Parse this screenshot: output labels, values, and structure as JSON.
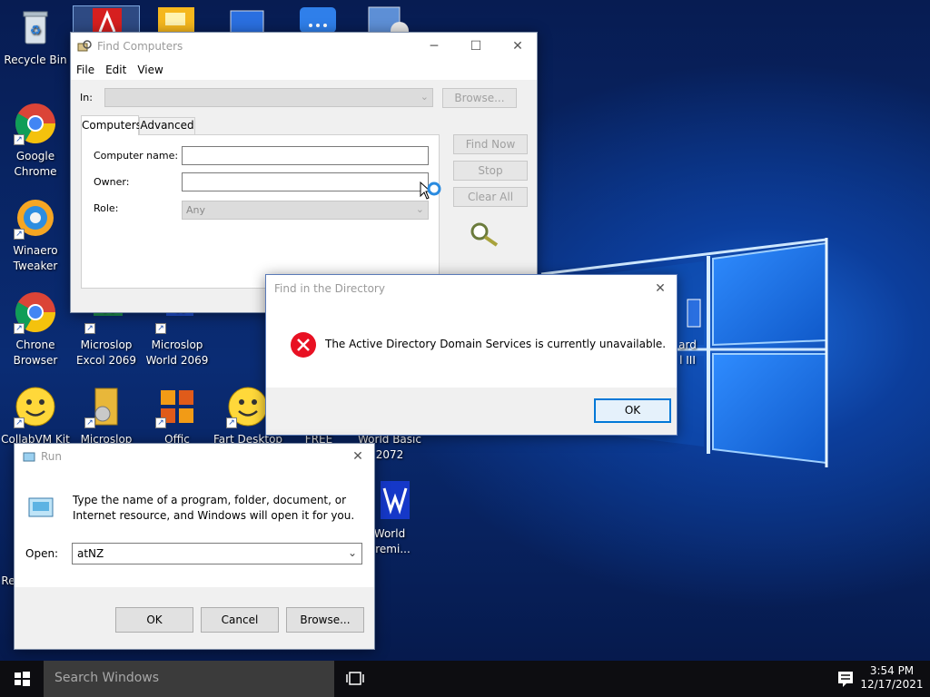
{
  "desktop": {
    "icons": [
      {
        "label": "Recycle Bin",
        "icon": "recycle-bin-icon"
      },
      {
        "label": "Google\nChrome",
        "icon": "chrome-icon"
      },
      {
        "label": "Winaero\nTweaker",
        "icon": "winaero-tweaker-icon"
      },
      {
        "label": "Chrone\nBrowser",
        "icon": "chrome-icon"
      },
      {
        "label": "CollabVM Kit",
        "icon": "smiley-icon"
      },
      {
        "label": "Microslop\nExcol 2069",
        "icon": "excel-icon"
      },
      {
        "label": "Microslop\nWorld 2069",
        "icon": "word-icon"
      },
      {
        "label": "Microslop",
        "icon": "folder-disc-icon"
      },
      {
        "label": "Offic",
        "icon": "office-logo-icon"
      },
      {
        "label": "Fart Desktop",
        "icon": "smiley-icon"
      },
      {
        "label": "FREE",
        "icon": "free-icon"
      },
      {
        "label": "World Basic\n2072",
        "icon": "app-icon"
      },
      {
        "label": "World\nPremi...",
        "icon": "word-premium-icon"
      },
      {
        "label": "ard\nl III",
        "icon": "app-icon"
      },
      {
        "label": "Re",
        "icon": "app-icon"
      }
    ]
  },
  "find_computers": {
    "title": "Find Computers",
    "menu": [
      "File",
      "Edit",
      "View"
    ],
    "in_label": "In:",
    "browse_label": "Browse...",
    "tabs": [
      "Computers",
      "Advanced"
    ],
    "computer_name_label": "Computer name:",
    "owner_label": "Owner:",
    "role_label": "Role:",
    "role_value": "Any",
    "find_now_label": "Find Now",
    "stop_label": "Stop",
    "clear_all_label": "Clear All"
  },
  "error_dialog": {
    "title": "Find in the Directory",
    "message": "The Active Directory Domain Services is currently unavailable.",
    "ok_label": "OK"
  },
  "run_dialog": {
    "title": "Run",
    "description": "Type the name of a program, folder, document, or\nInternet resource, and Windows will open it for you.",
    "open_label": "Open:",
    "open_value": "atNZ",
    "ok_label": "OK",
    "cancel_label": "Cancel",
    "browse_label": "Browse..."
  },
  "taskbar": {
    "search_placeholder": "Search Windows",
    "time": "3:54 PM",
    "date": "12/17/2021"
  },
  "colors": {
    "accent": "#0078d7",
    "error_red": "#e81123",
    "desktop_blue": "#0a2c74"
  }
}
